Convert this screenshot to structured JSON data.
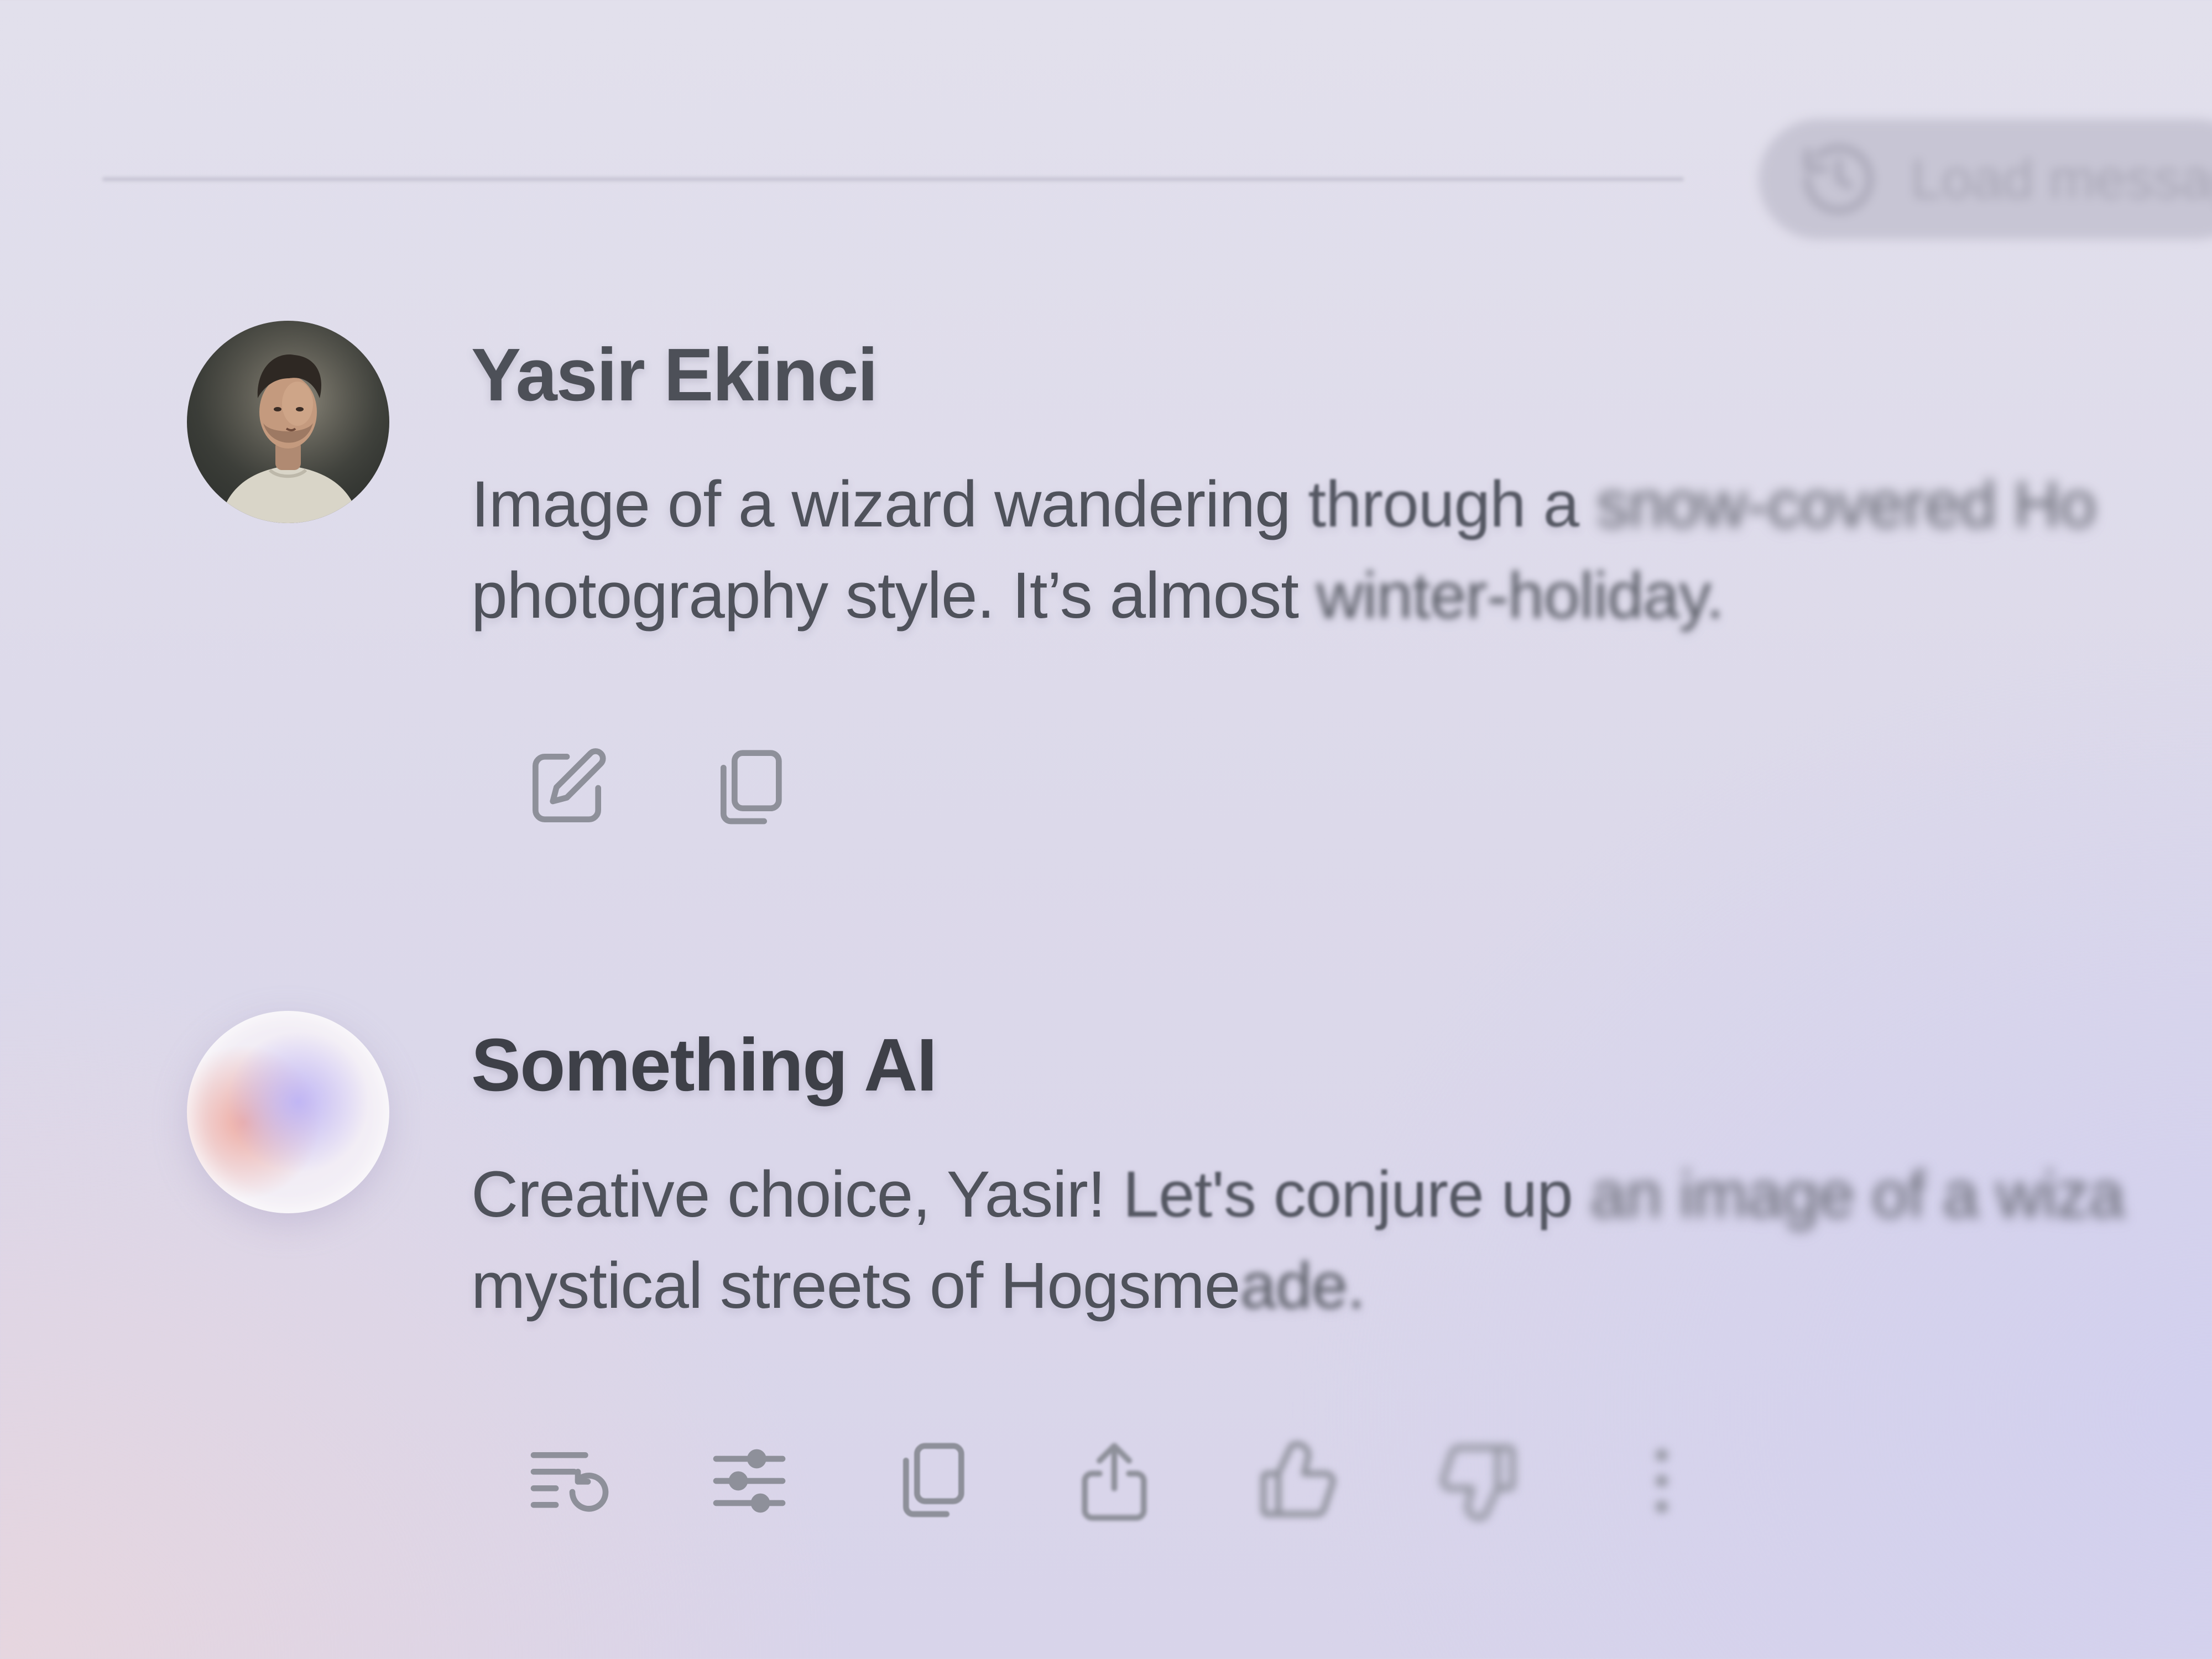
{
  "toolbar": {
    "load_label": "Load messages",
    "load_icon": "history-icon"
  },
  "messages": [
    {
      "sender": "Yasir Ekinci",
      "avatar": "user-photo",
      "text_line1_a": "Image of a wizard wandering",
      "text_line1_b": " through a",
      "text_line1_c": " snow-covered Ho",
      "text_line2_a": "photography style. It’s almost",
      "text_line2_b": " winter-holiday.",
      "actions": [
        {
          "icon": "edit-icon",
          "label": "Edit"
        },
        {
          "icon": "copy-icon",
          "label": "Copy"
        }
      ]
    },
    {
      "sender": "Something AI",
      "avatar": "ai-orb",
      "text_line1_a": "Creative choice, Yasir!",
      "text_line1_b": " Let's conjure up",
      "text_line1_c": " an image of a wiza",
      "text_line2_a": "mystical streets of Hogsme",
      "text_line2_b": "ade.",
      "actions": [
        {
          "icon": "regenerate-icon",
          "label": "Regenerate"
        },
        {
          "icon": "adjust-icon",
          "label": "Adjust"
        },
        {
          "icon": "copy-icon",
          "label": "Copy"
        },
        {
          "icon": "share-icon",
          "label": "Share"
        },
        {
          "icon": "thumbs-up-icon",
          "label": "Like"
        },
        {
          "icon": "thumbs-down-icon",
          "label": "Dislike"
        },
        {
          "icon": "more-icon",
          "label": "More"
        }
      ]
    }
  ],
  "colors": {
    "text_primary": "#4d5058",
    "icon_gray": "#8d8f99",
    "background": "#dcd9ea"
  }
}
